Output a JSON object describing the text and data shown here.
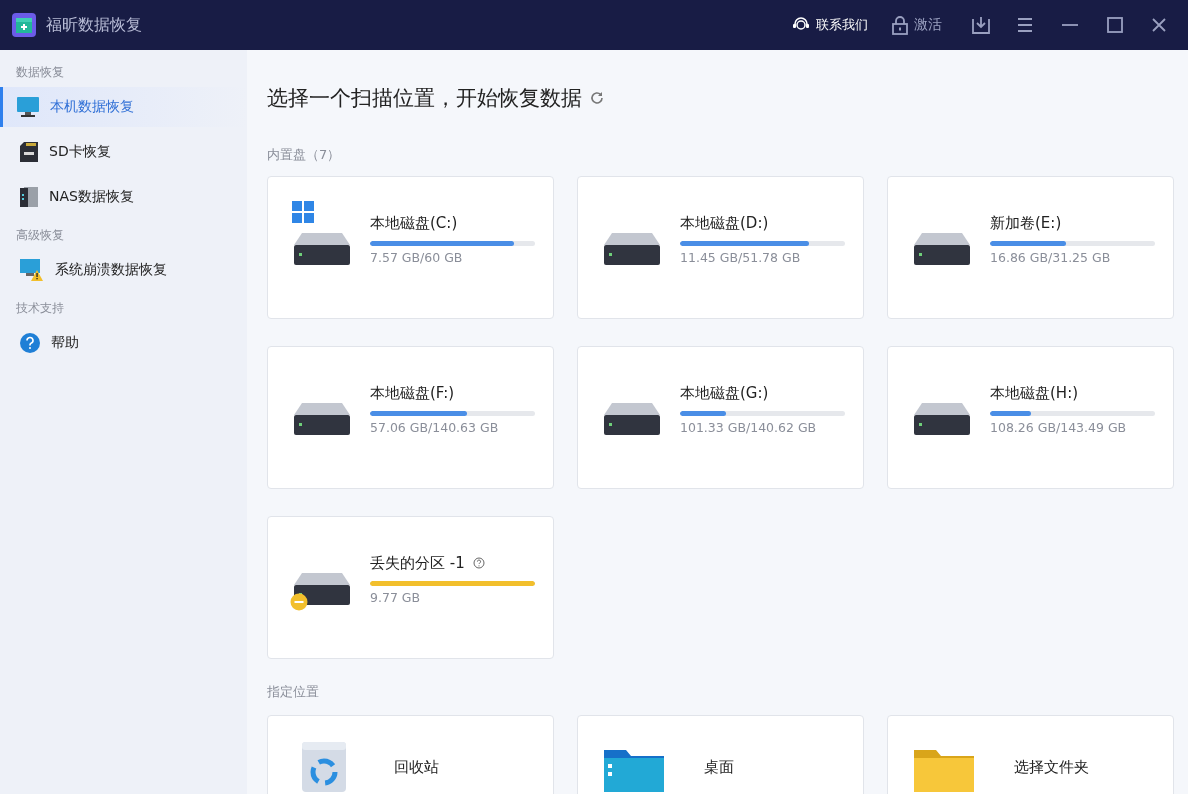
{
  "window": {
    "title": "福昕数据恢复",
    "actions": [
      {
        "kind": "contact",
        "label": "联系我们"
      },
      {
        "kind": "activate",
        "label": "激活"
      }
    ]
  },
  "sidebar": {
    "groups": [
      {
        "heading": "数据恢复",
        "items": [
          {
            "kind": "computer",
            "label": "本机数据恢复",
            "selected": true
          },
          {
            "kind": "sd",
            "label": "SD卡恢复",
            "selected": false
          },
          {
            "kind": "nas",
            "label": "NAS数据恢复",
            "selected": false
          }
        ]
      },
      {
        "heading": "高级恢复",
        "items": [
          {
            "kind": "crash",
            "label": "系统崩溃数据恢复",
            "selected": false
          }
        ]
      },
      {
        "heading": "技术支持",
        "items": [
          {
            "kind": "help",
            "label": "帮助",
            "selected": false
          }
        ]
      }
    ]
  },
  "main": {
    "title": "选择一个扫描位置，开始恢复数据",
    "internal": {
      "heading": "内置盘（7）",
      "drives": [
        {
          "kind": "system",
          "name": "本地磁盘(C:)",
          "size": "7.57 GB/60 GB",
          "level": 0.87,
          "color": "#4a8ee6"
        },
        {
          "kind": "normal",
          "name": "本地磁盘(D:)",
          "size": "11.45 GB/51.78 GB",
          "level": 0.78,
          "color": "#4a8ee6"
        },
        {
          "kind": "normal",
          "name": "新加卷(E:)",
          "size": "16.86 GB/31.25 GB",
          "level": 0.46,
          "color": "#4a8ee6"
        },
        {
          "kind": "normal",
          "name": "本地磁盘(F:)",
          "size": "57.06 GB/140.63 GB",
          "level": 0.59,
          "color": "#4a8ee6"
        },
        {
          "kind": "normal",
          "name": "本地磁盘(G:)",
          "size": "101.33 GB/140.62 GB",
          "level": 0.28,
          "color": "#4a8ee6"
        },
        {
          "kind": "normal",
          "name": "本地磁盘(H:)",
          "size": "108.26 GB/143.49 GB",
          "level": 0.25,
          "color": "#4a8ee6"
        },
        {
          "kind": "lost",
          "name": "丢失的分区 -1",
          "size": "9.77 GB",
          "level": 1,
          "color": "#f2bf2c"
        }
      ]
    },
    "locations": {
      "heading": "指定位置",
      "items": [
        {
          "kind": "recycle",
          "label": "回收站"
        },
        {
          "kind": "desktop",
          "label": "桌面"
        },
        {
          "kind": "folder",
          "label": "选择文件夹"
        }
      ]
    }
  }
}
